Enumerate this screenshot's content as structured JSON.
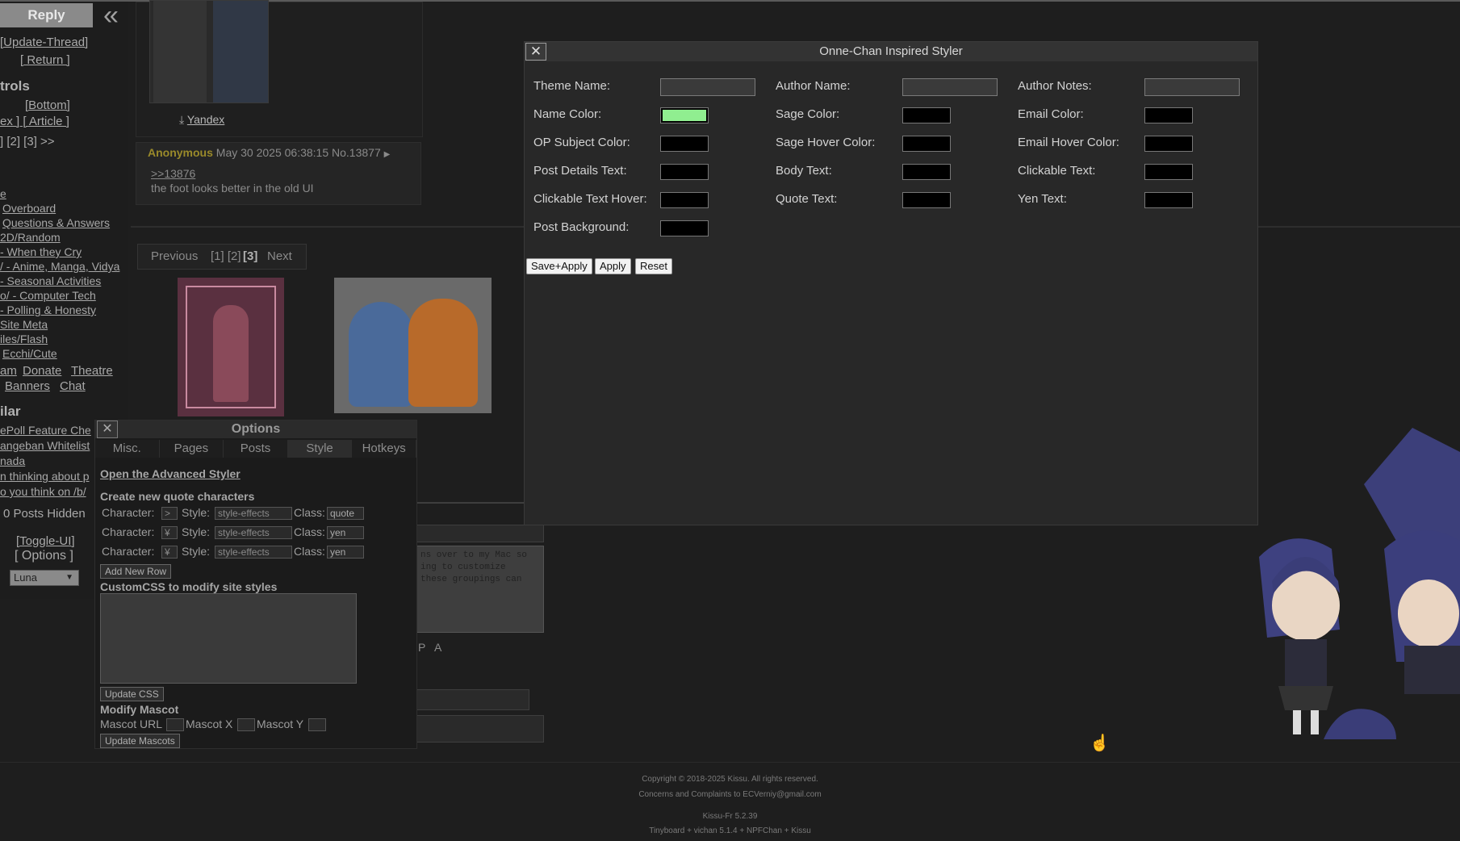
{
  "sidebar": {
    "reply_label": "Reply",
    "update_thread": "[Update-Thread]",
    "return": "[ Return ]",
    "controls_heading": "trols",
    "bottom": "[Bottom]",
    "index_article": "ex ]  [ Article ]",
    "pages": "] [2] [3] >>",
    "boards": [
      "e",
      "Overboard",
      "Questions & Answers",
      "2D/Random",
      "- When they Cry",
      "/ - Anime, Manga, Vidya",
      "- Seasonal Activities",
      "o/ - Computer Tech",
      "- Polling & Honesty",
      "Site Meta",
      "iles/Flash",
      "Ecchi/Cute"
    ],
    "links_row1": [
      "am",
      "Donate",
      "Theatre"
    ],
    "links_row2": [
      "Banners",
      "Chat"
    ],
    "similar_heading": "ilar",
    "similar": [
      "ePoll Feature Che",
      "angeban Whitelist",
      "nada",
      "n thinking about p",
      "o you think on /b/"
    ],
    "posts_hidden": "0 Posts Hidden",
    "toggle_ui": "[Toggle-UI]",
    "options": "[ Options ]",
    "theme_select": "Luna"
  },
  "thread": {
    "yandex": "Yandex",
    "post": {
      "name": "Anonymous",
      "date": "May 30 2025 06:38:15",
      "no": "No.13877",
      "reply_link": ">>13876",
      "body": "the foot looks better in the old UI"
    },
    "pager": {
      "previous": "Previous",
      "pages": "[1] [2]",
      "current": "[3]",
      "next": "Next"
    },
    "form_text": "ns over to my Mac so\ning to customize\nthese groupings can",
    "form_letters": "P   A"
  },
  "options_panel": {
    "title": "Options",
    "tabs": [
      "Misc.",
      "Pages",
      "Posts",
      "Style",
      "Hotkeys"
    ],
    "active_tab": "Style",
    "advanced_link": "Open the Advanced Styler",
    "quote_heading": "Create new quote characters",
    "char_label": "Character:",
    "style_label": "Style:",
    "class_label": "Class:",
    "rows": [
      {
        "char": ">",
        "style": "style-effects",
        "class": "quote"
      },
      {
        "char": "¥",
        "style": "style-effects",
        "class": "yen"
      },
      {
        "char": "¥",
        "style": "style-effects",
        "class": "yen"
      }
    ],
    "add_row": "Add New Row",
    "css_heading": "CustomCSS to modify site styles",
    "update_css": "Update CSS",
    "mascot_heading": "Modify Mascot",
    "mascot_url": "Mascot URL",
    "mascot_x": "Mascot X",
    "mascot_y": "Mascot Y",
    "update_mascots": "Update Mascots"
  },
  "styler": {
    "title": "Onne-Chan Inspired Styler",
    "close_icon": "close-icon",
    "fields": {
      "theme_name": "Theme Name:",
      "author_name": "Author Name:",
      "author_notes": "Author Notes:",
      "name_color": "Name Color:",
      "sage_color": "Sage Color:",
      "email_color": "Email Color:",
      "op_subject_color": "OP Subject Color:",
      "sage_hover_color": "Sage Hover Color:",
      "email_hover_color": "Email Hover Color:",
      "post_details_text": "Post Details Text:",
      "body_text": "Body Text:",
      "clickable_text": "Clickable Text:",
      "clickable_text_hover": "Clickable Text Hover:",
      "quote_text": "Quote Text:",
      "yen_text": "Yen Text:",
      "post_background": "Post Background:"
    },
    "colors": {
      "name_color": "#90ee90",
      "default": "#000000"
    },
    "buttons": {
      "save_apply": "Save+Apply",
      "apply": "Apply",
      "reset": "Reset"
    }
  },
  "footer": {
    "copyright": "Copyright © 2018-2025 Kissu. All rights reserved.",
    "complaints": "Concerns and Complaints to ECVerniy@gmail.com",
    "version": "Kissu-Fr 5.2.39",
    "software": "Tinyboard + vichan 5.1.4 + NPFChan + Kissu"
  }
}
